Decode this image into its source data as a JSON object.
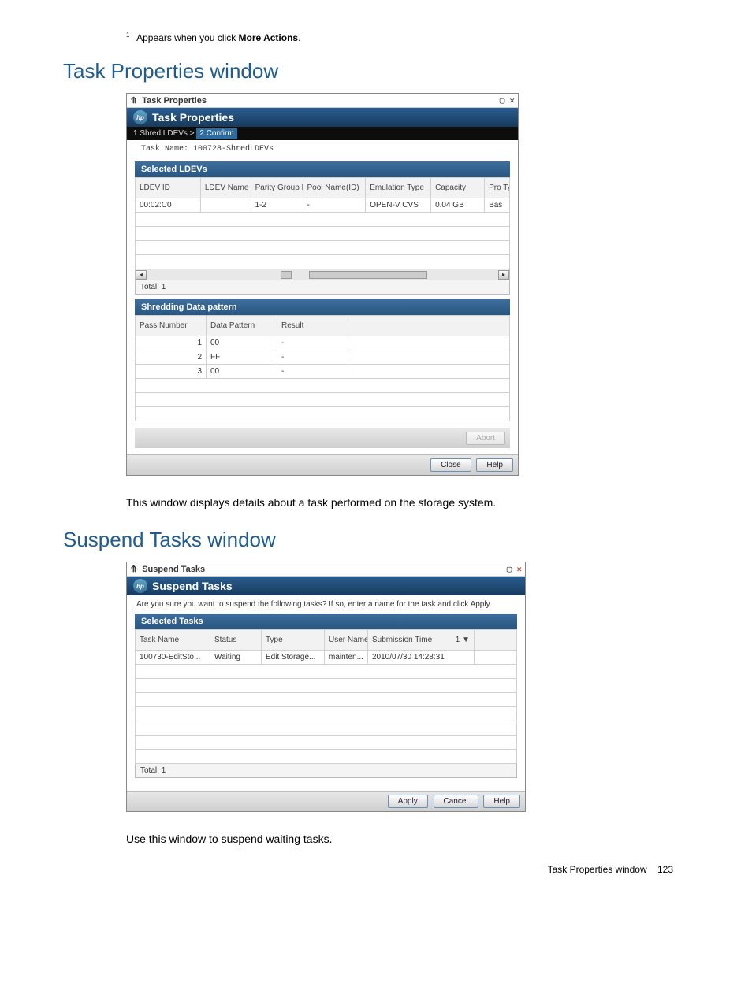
{
  "footnote": {
    "sup": "1",
    "pre": "Appears when you click ",
    "bold": "More Actions",
    "post": "."
  },
  "section1": {
    "heading": "Task Properties window",
    "body": "This window displays details about a task performed on the storage system."
  },
  "section2": {
    "heading": "Suspend Tasks window",
    "body": "Use this window to suspend waiting tasks."
  },
  "footer": {
    "label": "Task Properties window",
    "page": "123"
  },
  "ss1": {
    "title": "Task Properties",
    "banner": "Task Properties",
    "logo": "hp",
    "crumb1": "1.Shred LDEVs",
    "crumb_sep": ">",
    "crumb2": "2.Confirm",
    "task_name_label": "Task Name:",
    "task_name_value": "100728-ShredLDEVs",
    "ldevs": {
      "title": "Selected LDEVs",
      "headers": [
        "LDEV ID",
        "LDEV Name",
        "Parity Group ID",
        "Pool Name(ID)",
        "Emulation Type",
        "Capacity",
        "Pro Typ"
      ],
      "rows": [
        {
          "ldev_id": "00:02:C0",
          "ldev_name": "",
          "parity": "1-2",
          "pool": "-",
          "emul": "OPEN-V CVS",
          "cap": "0.04 GB",
          "pt": "Bas"
        }
      ],
      "total_label": "Total:",
      "total_value": "1"
    },
    "shred": {
      "title": "Shredding Data pattern",
      "headers": [
        "Pass Number",
        "Data Pattern",
        "Result"
      ],
      "rows": [
        {
          "pass": "1",
          "pat": "00",
          "res": "-"
        },
        {
          "pass": "2",
          "pat": "FF",
          "res": "-"
        },
        {
          "pass": "3",
          "pat": "00",
          "res": "-"
        }
      ]
    },
    "btn_abort": "Abort",
    "btn_close": "Close",
    "btn_help": "Help"
  },
  "ss2": {
    "title": "Suspend Tasks",
    "banner": "Suspend Tasks",
    "logo": "hp",
    "instruction": "Are you sure you want to suspend the following tasks? If so, enter a name for the task and click Apply.",
    "tasks": {
      "title": "Selected Tasks",
      "headers": [
        "Task Name",
        "Status",
        "Type",
        "User Name",
        "Submission Time"
      ],
      "sort_ind": "1 ▼",
      "rows": [
        {
          "name": "100730-EditSto...",
          "status": "Waiting",
          "type": "Edit Storage...",
          "user": "mainten...",
          "time": "2010/07/30 14:28:31"
        }
      ],
      "total_label": "Total:",
      "total_value": "1"
    },
    "btn_apply": "Apply",
    "btn_cancel": "Cancel",
    "btn_help": "Help"
  }
}
